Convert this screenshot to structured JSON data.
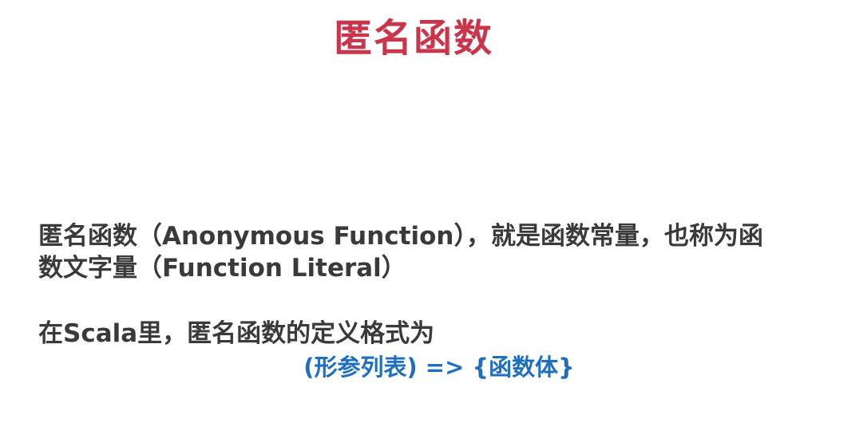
{
  "slide": {
    "title": "匿名函数",
    "paragraph_line1": "匿名函数（Anonymous Function），就是函数常量，也称为函",
    "paragraph_line2": "数文字量（Function Literal）",
    "format_intro": "在Scala里，匿名函数的定义格式为",
    "syntax": "(形参列表) => {函数体}"
  },
  "colors": {
    "title": "#c9354a",
    "body_text": "#3a3a3a",
    "syntax": "#1f6fc0"
  }
}
